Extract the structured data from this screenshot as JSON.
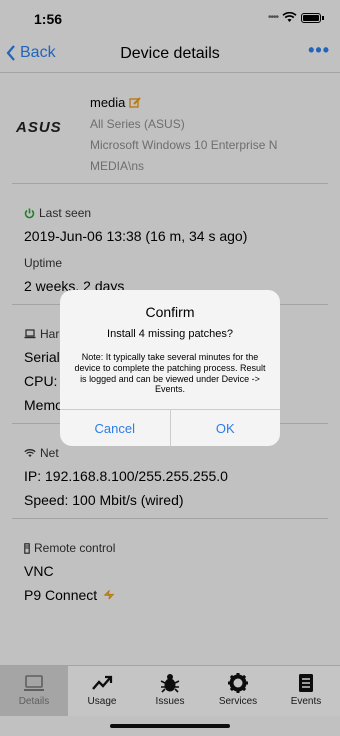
{
  "status_bar": {
    "time": "1:56"
  },
  "nav": {
    "back_label": "Back",
    "title": "Device details",
    "more_label": "•••"
  },
  "device": {
    "brand": "ASUS",
    "name": "media",
    "series": "All Series (ASUS)",
    "os": "Microsoft Windows 10 Enterprise N",
    "account": "MEDIA\\ns"
  },
  "last_seen": {
    "heading": "Last seen",
    "value": "2019-Jun-06 13:38 (16 m, 34 s ago)",
    "uptime_label": "Uptime",
    "uptime_value": "2 weeks, 2 days"
  },
  "hardware": {
    "heading": "Har",
    "serial": "Serial:",
    "cpu": "CPU: I",
    "memory": "Memo"
  },
  "network": {
    "heading": "Net",
    "ip": "IP: 192.168.8.100/255.255.255.0",
    "speed": "Speed: 100 Mbit/s (wired)"
  },
  "remote": {
    "heading": "Remote control",
    "vnc": "VNC",
    "p9": "P9 Connect"
  },
  "tabs": [
    {
      "label": "Details",
      "icon": "laptop-icon"
    },
    {
      "label": "Usage",
      "icon": "trend-icon"
    },
    {
      "label": "Issues",
      "icon": "bug-icon"
    },
    {
      "label": "Services",
      "icon": "gear-icon"
    },
    {
      "label": "Events",
      "icon": "list-icon"
    }
  ],
  "dialog": {
    "title": "Confirm",
    "message": "Install 4 missing patches?",
    "note": "Note: It typically take several minutes for the device to complete the patching process. Result is logged and can be viewed under Device -> Events.",
    "cancel": "Cancel",
    "ok": "OK"
  },
  "colors": {
    "accent": "#2b7de9",
    "power_green": "#2f9e3a",
    "edit_orange": "#e69a1c"
  }
}
